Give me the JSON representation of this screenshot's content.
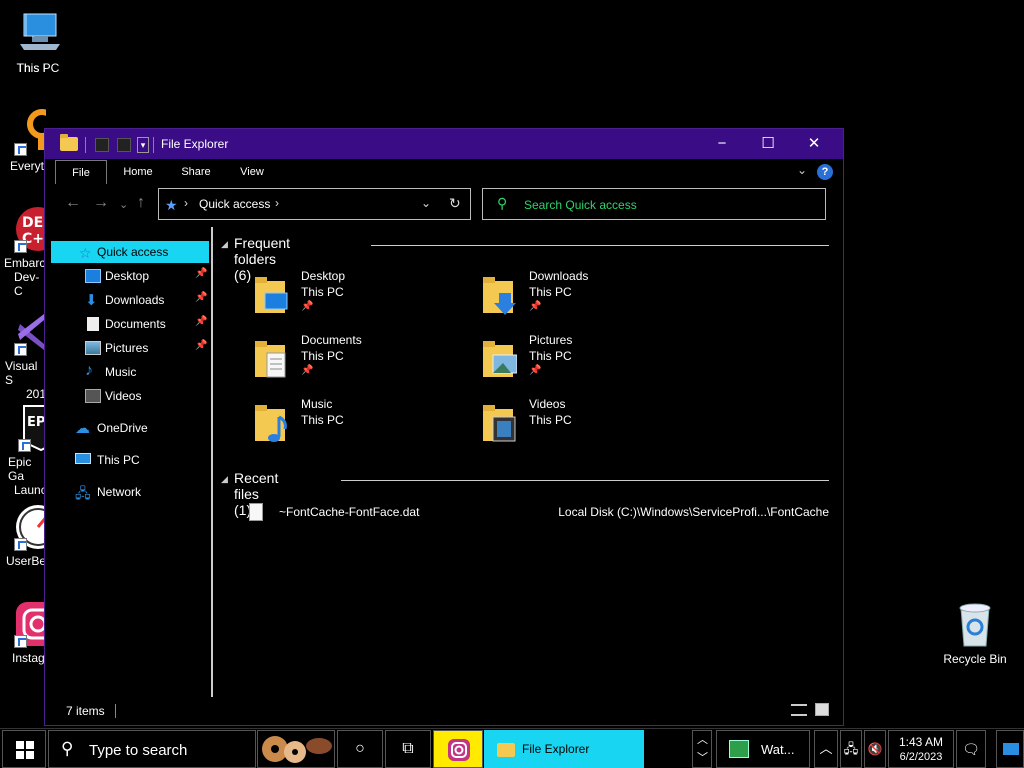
{
  "desktop": {
    "icons": [
      {
        "label": "This PC",
        "icon": "computer-icon"
      },
      {
        "label": "Everyt",
        "icon": "everything-icon"
      },
      {
        "label": "Embarc",
        "label2": "Dev-C",
        "icon": "devcpp-icon"
      },
      {
        "label": "Visual S",
        "label2": "201",
        "icon": "visual-studio-icon"
      },
      {
        "label": "Epic Ga",
        "label2": "Launc",
        "icon": "epic-games-icon"
      },
      {
        "label": "UserBen",
        "icon": "userbenchmark-icon"
      },
      {
        "label": "Instag",
        "icon": "instagram-icon"
      }
    ],
    "recycle_bin": "Recycle Bin"
  },
  "window": {
    "title": "File Explorer",
    "minimize": "−",
    "maximize": "☐",
    "close": "✕",
    "ribbon_tabs": [
      "File",
      "Home",
      "Share",
      "View"
    ],
    "help": "?",
    "address": {
      "location": "Quick access"
    },
    "search": {
      "placeholder": "Search Quick access"
    },
    "sidebar": [
      {
        "label": "Quick access",
        "icon": "star-icon",
        "pinned": false,
        "selected": true
      },
      {
        "label": "Desktop",
        "icon": "desktop-folder-icon",
        "pinned": true
      },
      {
        "label": "Downloads",
        "icon": "download-arrow-icon",
        "pinned": true
      },
      {
        "label": "Documents",
        "icon": "document-icon",
        "pinned": true
      },
      {
        "label": "Pictures",
        "icon": "picture-icon",
        "pinned": true
      },
      {
        "label": "Music",
        "icon": "music-note-icon",
        "pinned": false
      },
      {
        "label": "Videos",
        "icon": "film-icon",
        "pinned": false
      },
      {
        "label": "OneDrive",
        "icon": "cloud-icon",
        "pinned": false
      },
      {
        "label": "This PC",
        "icon": "computer-icon",
        "pinned": false
      },
      {
        "label": "Network",
        "icon": "network-icon",
        "pinned": false
      }
    ],
    "frequent": {
      "heading": "Frequent folders (6)",
      "folders": [
        {
          "name": "Desktop",
          "location": "This PC",
          "pinned": true,
          "icon": "desktop-folder-icon"
        },
        {
          "name": "Downloads",
          "location": "This PC",
          "pinned": true,
          "icon": "downloads-folder-icon"
        },
        {
          "name": "Documents",
          "location": "This PC",
          "pinned": true,
          "icon": "documents-folder-icon"
        },
        {
          "name": "Pictures",
          "location": "This PC",
          "pinned": true,
          "icon": "pictures-folder-icon"
        },
        {
          "name": "Music",
          "location": "This PC",
          "pinned": false,
          "icon": "music-folder-icon"
        },
        {
          "name": "Videos",
          "location": "This PC",
          "pinned": false,
          "icon": "videos-folder-icon"
        }
      ]
    },
    "recent": {
      "heading": "Recent files (1)",
      "files": [
        {
          "name": "~FontCache-FontFace.dat",
          "path": "Local Disk (C:)\\Windows\\ServiceProfi...\\FontCache"
        }
      ]
    },
    "status": {
      "items": "7 items"
    }
  },
  "taskbar": {
    "search_placeholder": "Type to search",
    "file_explorer": "File Explorer",
    "watch": "Wat...",
    "time": "1:43 AM",
    "date": "6/2/2023"
  },
  "colors": {
    "titlebar": "#3a0d86",
    "selection": "#18d6f2",
    "search_text": "#2fd46a",
    "taskbar_highlight": "#ffea00"
  }
}
